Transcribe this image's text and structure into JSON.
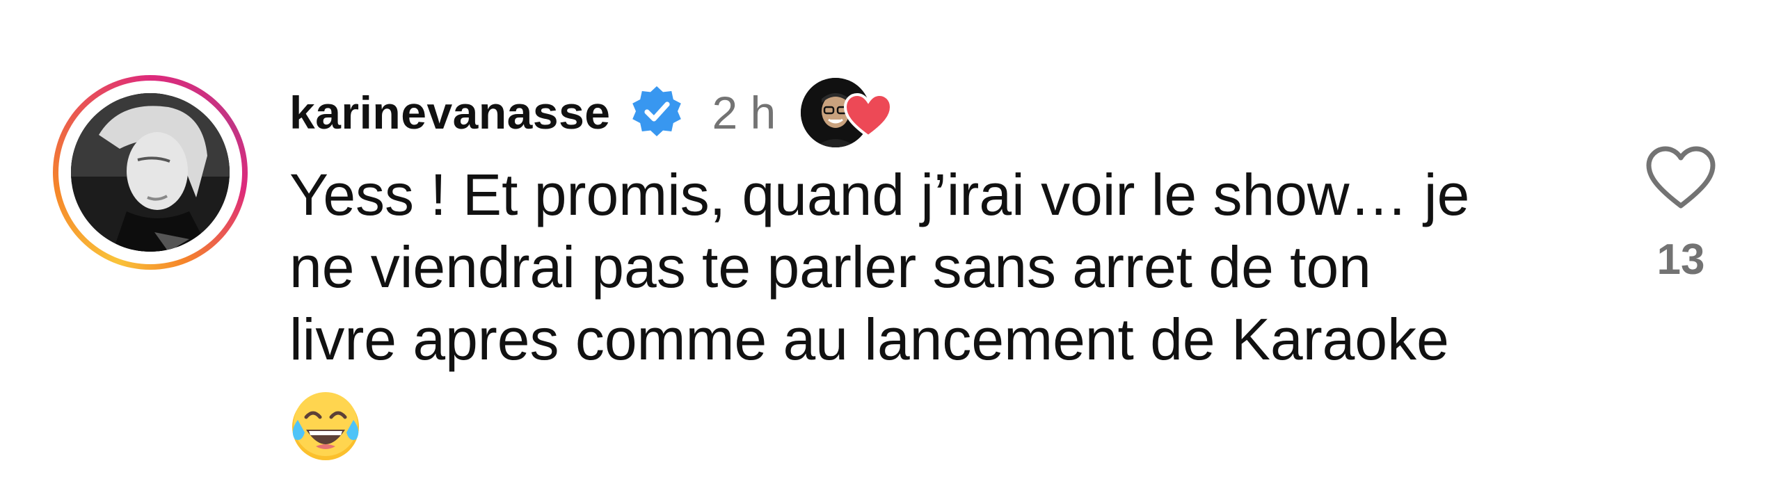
{
  "comment": {
    "username": "karinevanasse",
    "timestamp": "2 h",
    "text": "Yess ! Et promis, quand j’irai voir le show… je\nne viendrai pas te parler sans arret de ton\nlivre apres comme au lancement de Karaoke",
    "trailing_emoji": "face-with-tears-of-joy",
    "like_count": "13",
    "verified": true,
    "liked_by_author_icon": "author-avatar-heart"
  },
  "icons": {
    "verified": "verified-badge-icon",
    "like": "heart-outline-icon",
    "author_like": "heart-filled-icon"
  },
  "colors": {
    "verified_blue": "#3897f0",
    "heart_red": "#ed4956",
    "muted_text": "#737373",
    "story_ring_start": "#f9c33a",
    "story_ring_end": "#c13584"
  }
}
